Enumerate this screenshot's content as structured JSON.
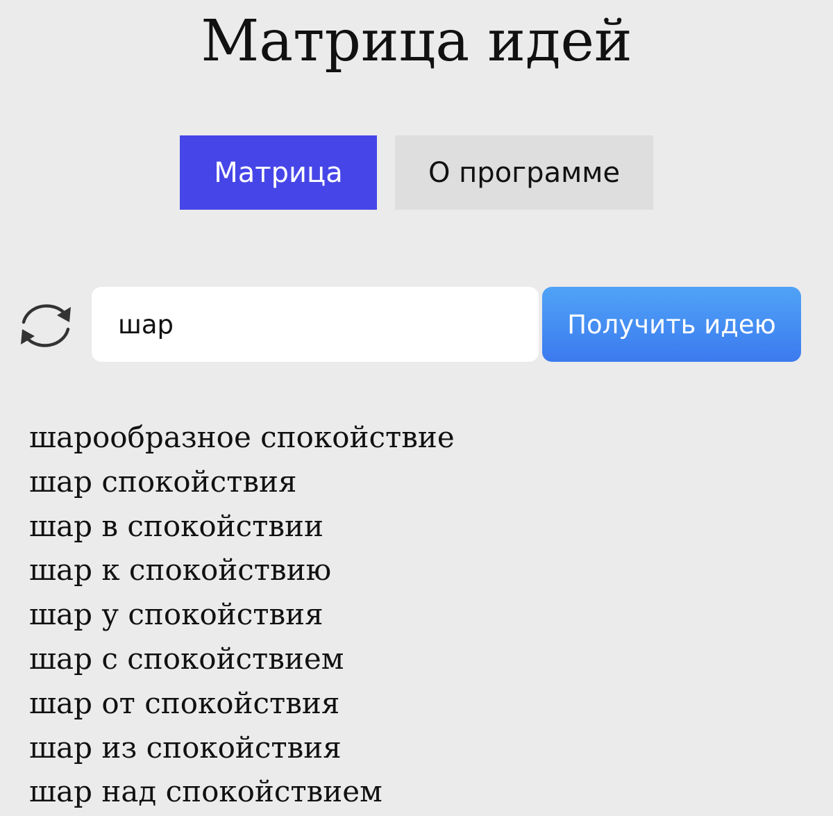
{
  "page_title": "Матрица идей",
  "tabs": [
    {
      "label": "Матрица",
      "active": true
    },
    {
      "label": "О программе",
      "active": false
    }
  ],
  "search": {
    "value": "шар",
    "button_label": "Получить идею",
    "refresh_icon": "refresh-icon"
  },
  "results": [
    "шарообразное спокойствие",
    "шар спокойствия",
    "шар в спокойствии",
    "шар к спокойствию",
    "шар у спокойствия",
    "шар с спокойствием",
    "шар от спокойствия",
    "шар из спокойствия",
    "шар над спокойствием"
  ],
  "colors": {
    "background": "#ebebeb",
    "active_tab": "#4646e8",
    "inactive_tab": "#dedede",
    "button_top": "#4fa3f6",
    "button_bottom": "#3c7aef"
  }
}
